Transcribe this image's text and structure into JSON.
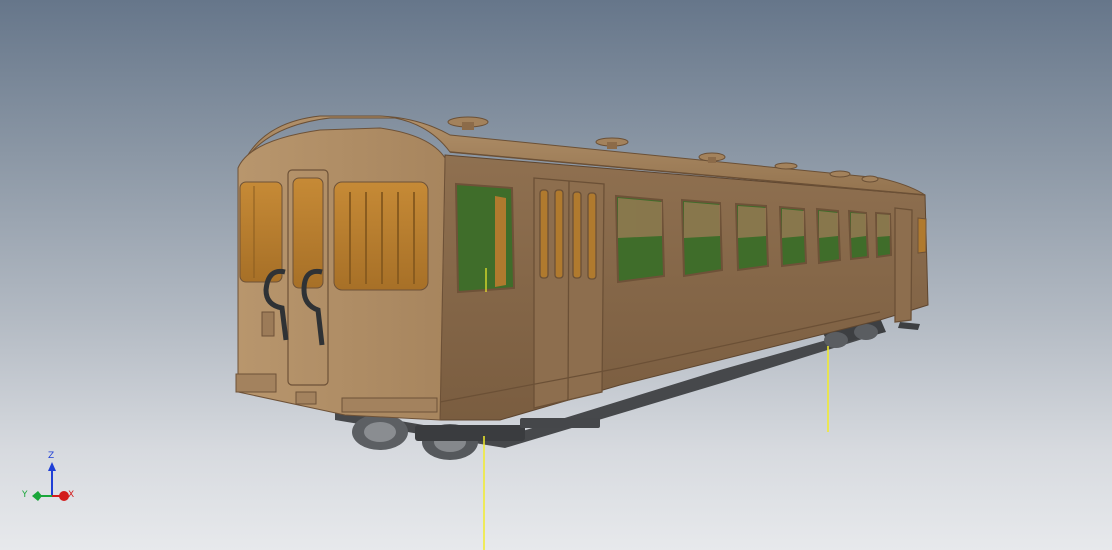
{
  "viewport": {
    "background_top": "#66768a",
    "background_bottom": "#e7e9ec"
  },
  "model": {
    "object": "railcar",
    "body_color": "#8a6c4c",
    "roof_color": "#9c7b58",
    "window_glass_orange": "#b07a2e",
    "window_glass_green": "#3f6d2a",
    "underframe_color": "#3b3d40",
    "constraint_line_color": "#f2ec2a"
  },
  "triad": {
    "z_label": "Z",
    "y_label": "Y",
    "x_label": "X",
    "z_color": "#1f3fd6",
    "y_color": "#1aa63a",
    "x_color": "#d31b1b"
  }
}
